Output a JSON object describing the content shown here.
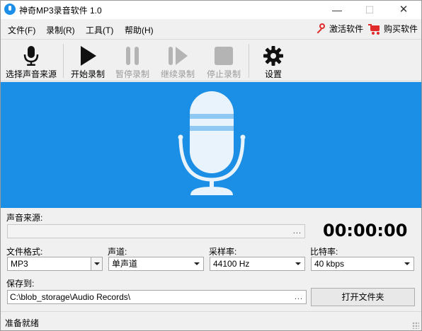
{
  "window": {
    "title": "神奇MP3录音软件 1.0",
    "minimize_glyph": "—",
    "maximize_glyph": "☐",
    "close_glyph": "✕"
  },
  "menu": {
    "items": [
      "文件(F)",
      "录制(R)",
      "工具(T)",
      "帮助(H)"
    ],
    "activate_label": "激活软件",
    "buy_label": "购买软件"
  },
  "toolbar": {
    "select_source": "选择声音来源",
    "start": "开始录制",
    "pause": "暂停录制",
    "resume": "继续录制",
    "stop": "停止录制",
    "settings": "设置"
  },
  "form": {
    "source_label": "声音来源:",
    "source_value": "",
    "browse_dots": "...",
    "timer": "00:00:00",
    "format_label": "文件格式:",
    "format_value": "MP3",
    "channel_label": "声道:",
    "channel_value": "单声道",
    "samplerate_label": "采样率:",
    "samplerate_value": "44100 Hz",
    "bitrate_label": "比特率:",
    "bitrate_value": "40 kbps",
    "save_label": "保存到:",
    "save_path": "C:\\blob_storage\\Audio Records\\",
    "open_folder": "打开文件夹"
  },
  "status": {
    "text": "准备就绪"
  },
  "colors": {
    "hero_blue": "#1b8ee6",
    "accent_red": "#e02a2a",
    "mic_body": "#e8f3fc",
    "mic_stripe": "#8fc8f2"
  },
  "icons": {
    "app": "app-icon",
    "key": "key-icon",
    "cart": "cart-icon",
    "microphone": "microphone-icon",
    "play": "play-icon",
    "pause": "pause-icon",
    "resume": "resume-icon",
    "stop": "stop-icon",
    "gear": "gear-icon"
  }
}
